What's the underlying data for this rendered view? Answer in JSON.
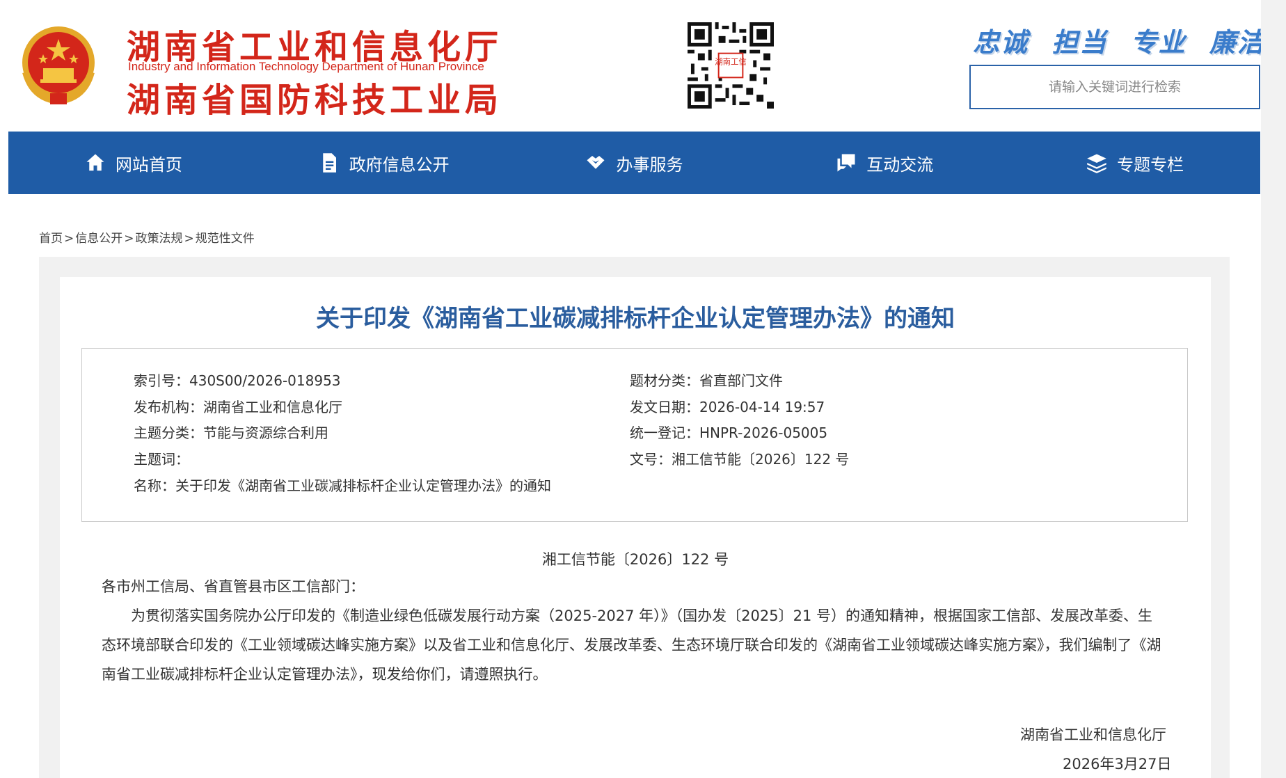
{
  "header": {
    "title_line1": "湖南省工业和信息化厅",
    "title_en": "Industry and Information Technology Department of Hunan Province",
    "title_line2": "湖南省国防科技工业局",
    "slogans": [
      "忠诚",
      "担当",
      "专业",
      "廉洁"
    ],
    "search_placeholder": "请输入关键词进行检索",
    "qr_label": "湖南工信",
    "colors": {
      "brand_red": "#d3261a",
      "nav_blue": "#1f5ca6",
      "title_blue": "#2a5d9e"
    }
  },
  "nav": {
    "items": [
      {
        "label": "网站首页",
        "icon": "home-icon"
      },
      {
        "label": "政府信息公开",
        "icon": "document-icon"
      },
      {
        "label": "办事服务",
        "icon": "handshake-icon"
      },
      {
        "label": "互动交流",
        "icon": "chat-icon"
      },
      {
        "label": "专题专栏",
        "icon": "layers-icon"
      }
    ]
  },
  "breadcrumb": {
    "items": [
      "首页",
      "信息公开",
      "政策法规",
      "规范性文件"
    ],
    "separator": ">"
  },
  "document": {
    "title": "关于印发《湖南省工业碳减排标杆企业认定管理办法》的通知",
    "meta": {
      "index_no": {
        "label": "索引号：",
        "value": "430S00/2026-018953"
      },
      "publisher": {
        "label": "发布机构：",
        "value": "湖南省工业和信息化厅"
      },
      "topic": {
        "label": "主题分类：",
        "value": "节能与资源综合利用"
      },
      "keywords": {
        "label": "主题词：",
        "value": ""
      },
      "name": {
        "label": "名称：",
        "value": "关于印发《湖南省工业碳减排标杆企业认定管理办法》的通知"
      },
      "genre": {
        "label": "题材分类：",
        "value": "省直部门文件"
      },
      "issue_date": {
        "label": "发文日期：",
        "value": "2026-04-14 19:57"
      },
      "registration": {
        "label": "统一登记：",
        "value": "HNPR-2026-05005"
      },
      "doc_number": {
        "label": "文号：",
        "value": "湘工信节能〔2026〕122 号"
      }
    },
    "doc_no": "湘工信节能〔2026〕122 号",
    "salutation": "各市州工信局、省直管县市区工信部门：",
    "body": "为贯彻落实国务院办公厅印发的《制造业绿色低碳发展行动方案（2025-2027 年）》（国办发〔2025〕21 号）的通知精神，根据国家工信部、发展改革委、生态环境部联合印发的《工业领域碳达峰实施方案》以及省工业和信息化厅、发展改革委、生态环境厅联合印发的《湖南省工业领域碳达峰实施方案》，我们编制了《湖南省工业碳减排标杆企业认定管理办法》，现发给你们，请遵照执行。",
    "signature": "湖南省工业和信息化厅",
    "sign_date": "2026年3月27日"
  }
}
